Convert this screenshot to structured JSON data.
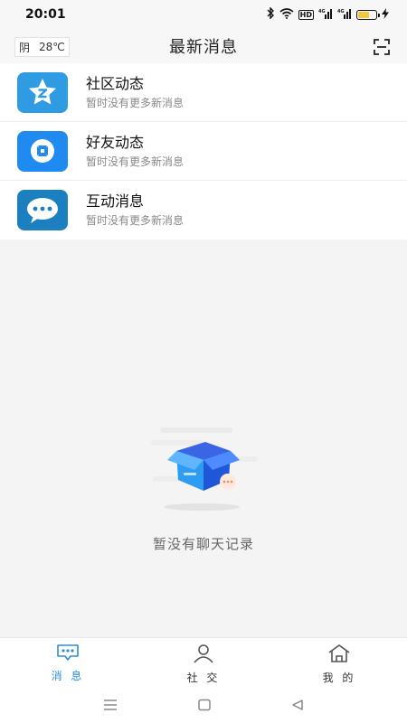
{
  "status_bar": {
    "time": "20:01",
    "signal_label": "4G"
  },
  "header": {
    "weather_condition": "阴",
    "weather_temp": "28℃",
    "title": "最新消息"
  },
  "messages": [
    {
      "title": "社区动态",
      "subtitle": "暂时没有更多新消息",
      "icon": "community-star-icon",
      "color": "#2e9be3"
    },
    {
      "title": "好友动态",
      "subtitle": "暂时没有更多新消息",
      "icon": "friend-shutter-icon",
      "color": "#1f8bf0"
    },
    {
      "title": "互动消息",
      "subtitle": "暂时没有更多新消息",
      "icon": "chat-bubble-icon",
      "color": "#1c7fbf"
    }
  ],
  "empty_state": {
    "text": "暂没有聊天记录"
  },
  "tabs": [
    {
      "label": "消 息",
      "icon": "message-icon",
      "active": true
    },
    {
      "label": "社 交",
      "icon": "person-icon",
      "active": false
    },
    {
      "label": "我 的",
      "icon": "home-icon",
      "active": false
    }
  ],
  "colors": {
    "accent": "#2a8fd9"
  }
}
